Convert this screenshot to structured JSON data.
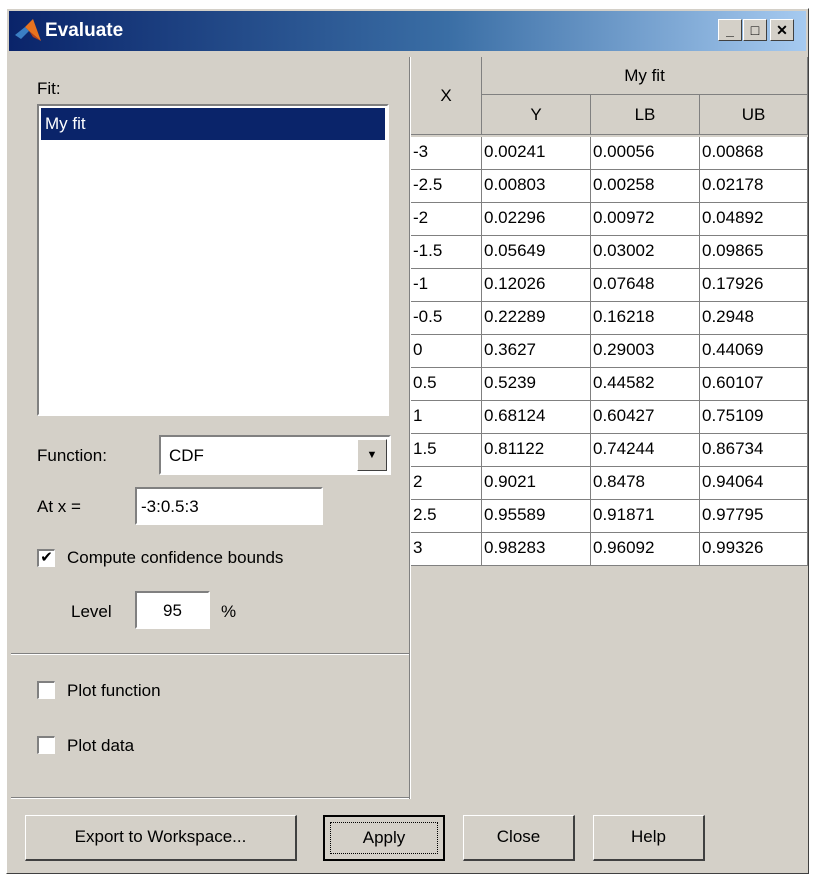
{
  "window": {
    "title": "Evaluate"
  },
  "left": {
    "fit_label": "Fit:",
    "fits": [
      "My fit"
    ],
    "function_label": "Function:",
    "function_value": "CDF",
    "at_x_label": "At x =",
    "at_x_value": "-3:0.5:3",
    "confidence_label": "Compute confidence bounds",
    "confidence_checked": true,
    "level_label": "Level",
    "level_value": "95",
    "level_unit": "%",
    "plot_function_label": "Plot function",
    "plot_data_label": "Plot data"
  },
  "table": {
    "x_header": "X",
    "group_header": "My fit",
    "columns": [
      "Y",
      "LB",
      "UB"
    ],
    "rows": [
      [
        "-3",
        "0.00241",
        "0.00056",
        "0.00868"
      ],
      [
        "-2.5",
        "0.00803",
        "0.00258",
        "0.02178"
      ],
      [
        "-2",
        "0.02296",
        "0.00972",
        "0.04892"
      ],
      [
        "-1.5",
        "0.05649",
        "0.03002",
        "0.09865"
      ],
      [
        "-1",
        "0.12026",
        "0.07648",
        "0.17926"
      ],
      [
        "-0.5",
        "0.22289",
        "0.16218",
        "0.2948"
      ],
      [
        "0",
        "0.3627",
        "0.29003",
        "0.44069"
      ],
      [
        "0.5",
        "0.5239",
        "0.44582",
        "0.60107"
      ],
      [
        "1",
        "0.68124",
        "0.60427",
        "0.75109"
      ],
      [
        "1.5",
        "0.81122",
        "0.74244",
        "0.86734"
      ],
      [
        "2",
        "0.9021",
        "0.8478",
        "0.94064"
      ],
      [
        "2.5",
        "0.95589",
        "0.91871",
        "0.97795"
      ],
      [
        "3",
        "0.98283",
        "0.96092",
        "0.99326"
      ]
    ]
  },
  "buttons": {
    "export": "Export to Workspace...",
    "apply": "Apply",
    "close": "Close",
    "help": "Help"
  },
  "colors": {
    "selection": "#0a246a",
    "face": "#d4d0c8"
  }
}
